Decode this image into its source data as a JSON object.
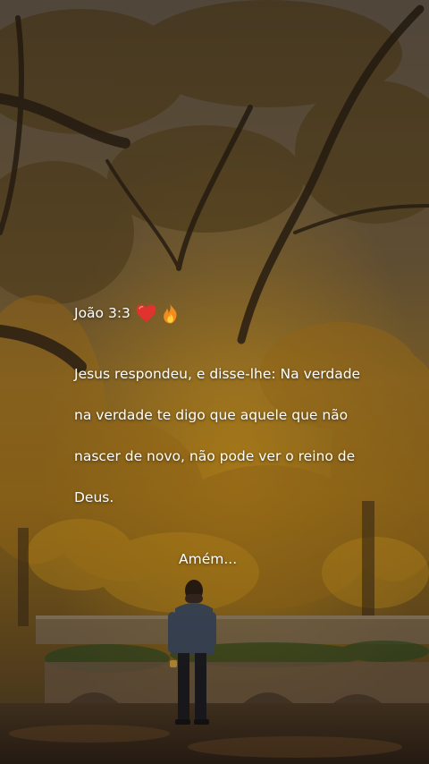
{
  "post": {
    "reference": "João 3:3",
    "reference_emojis": [
      "heart-icon",
      "fire-icon"
    ],
    "verse_lines": [
      "Jesus respondeu, e disse-lhe: Na verdade",
      "na verdade te digo que aquele que não",
      "nascer de novo, não pode ver o reino de",
      "Deus."
    ],
    "closing": "Amém..."
  },
  "colors": {
    "text": "#ffffff",
    "heart": "#e0332e",
    "fire": "#f28c1c",
    "foliage": "#b98416",
    "sky": "#9c9283"
  }
}
